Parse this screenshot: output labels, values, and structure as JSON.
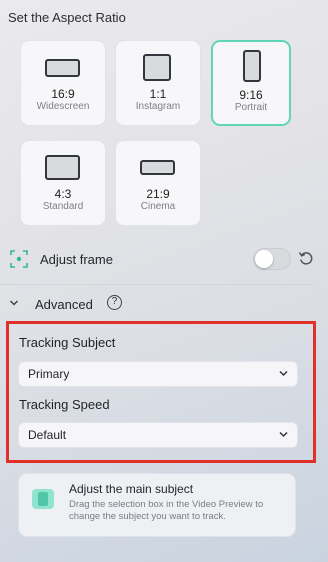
{
  "aspect": {
    "title": "Set the Aspect Ratio",
    "options": [
      {
        "ratio": "16:9",
        "name": "Widescreen",
        "selected": false
      },
      {
        "ratio": "1:1",
        "name": "Instagram",
        "selected": false
      },
      {
        "ratio": "9:16",
        "name": "Portrait",
        "selected": true
      },
      {
        "ratio": "4:3",
        "name": "Standard",
        "selected": false
      },
      {
        "ratio": "21:9",
        "name": "Cinema",
        "selected": false
      }
    ]
  },
  "adjust_frame": {
    "label": "Adjust frame",
    "enabled": false
  },
  "advanced": {
    "label": "Advanced",
    "help_icon": "?",
    "tracking_subject": {
      "label": "Tracking Subject",
      "value": "Primary"
    },
    "tracking_speed": {
      "label": "Tracking Speed",
      "value": "Default"
    }
  },
  "hint": {
    "title": "Adjust the main subject",
    "description": "Drag the selection box in the Video Preview to change the subject you want to track."
  },
  "colors": {
    "accent": "#5fd6b8",
    "highlight_box": "#e0302a"
  }
}
